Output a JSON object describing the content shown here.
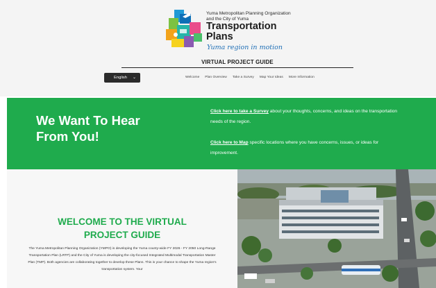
{
  "logo": {
    "org_line1": "Yuma Metropolitan Planning Organization",
    "org_line2": "and the City of Yuma",
    "title_line1": "Transportation",
    "title_line2": "Plans",
    "tagline": "Yuma region in motion"
  },
  "header": {
    "guide_title": "VIRTUAL PROJECT GUIDE",
    "language": "English"
  },
  "nav": {
    "items": [
      "Welcome",
      "Plan Overview",
      "Take a Survey",
      "Map Your Ideas",
      "More Information"
    ]
  },
  "hero": {
    "heading_line1": "We Want To Hear",
    "heading_line2": "From You!",
    "survey_link": "Click here to take a Survey",
    "survey_text": " about your thoughts, concerns, and ideas on the transportation needs of the region.",
    "map_link": "Click here to Map",
    "map_text": " specific locations where you have concerns, issues, or ideas for improvement."
  },
  "welcome": {
    "title_line1": "WELCOME TO THE  VIRTUAL",
    "title_line2": "PROJECT GUIDE",
    "body": "The Yuma Metropolitan Planning Organization (YMPO) is developing the Yuma county-wide FY 2026 - FY 2050 Long-Range Transportation Plan (LRTP) and the City of Yuma is developing the city-focused Integrated Multimodal Transportation Master Plan (TMP). Both agencies are collaborating together to develop these Plans. This is your chance to shape the Yuma region's transportation system. Your"
  },
  "colors": {
    "brand_green": "#1fab4d",
    "tagline_blue": "#1f6fb6",
    "header_bg": "#f4f4f4",
    "lang_bg": "#2b2b2b"
  },
  "icons": {
    "logo_mark": "transportation-collage-logo",
    "lang_chevron": "chevron-down-icon"
  }
}
